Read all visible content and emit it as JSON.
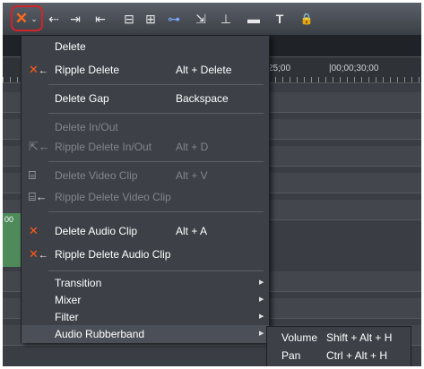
{
  "toolbar": {
    "delete_icon": "x-icon",
    "dropdown_arrow": "⌄",
    "glyphs": [
      "⇠",
      "⇥",
      "⇤",
      "⊟",
      "⊞",
      "⊶",
      "⇲",
      "⊥",
      "▬",
      "T",
      "🔒"
    ]
  },
  "timeline": {
    "ruler_left": "25;00",
    "ruler_right": "|00;00;30;00",
    "clip_label": "00"
  },
  "menu": {
    "items": [
      {
        "label": "Delete",
        "shortcut": "",
        "icon": "x-icon",
        "disabled": false
      },
      {
        "label": "Ripple Delete",
        "shortcut": "Alt + Delete",
        "icon": "ripple-x-icon",
        "disabled": false
      },
      {
        "label": "Delete Gap",
        "shortcut": "Backspace",
        "icon": "",
        "disabled": false
      },
      {
        "label": "Delete In/Out",
        "shortcut": "",
        "icon": "",
        "disabled": true
      },
      {
        "label": "Ripple Delete In/Out",
        "shortcut": "Alt + D",
        "icon": "ripple-inout-icon",
        "disabled": true
      },
      {
        "label": "Delete Video Clip",
        "shortcut": "Alt + V",
        "icon": "video-clip-icon",
        "disabled": true
      },
      {
        "label": "Ripple Delete Video Clip",
        "shortcut": "",
        "icon": "ripple-video-icon",
        "disabled": true
      },
      {
        "label": "Delete Audio Clip",
        "shortcut": "Alt + A",
        "icon": "audio-clip-icon",
        "disabled": false
      },
      {
        "label": "Ripple Delete Audio Clip",
        "shortcut": "",
        "icon": "ripple-audio-icon",
        "disabled": false
      },
      {
        "label": "Transition",
        "shortcut": "",
        "icon": "",
        "disabled": false,
        "submenu": true
      },
      {
        "label": "Mixer",
        "shortcut": "",
        "icon": "",
        "disabled": false,
        "submenu": true
      },
      {
        "label": "Filter",
        "shortcut": "",
        "icon": "",
        "disabled": false,
        "submenu": true
      },
      {
        "label": "Audio Rubberband",
        "shortcut": "",
        "icon": "",
        "disabled": false,
        "submenu": true
      }
    ]
  },
  "submenu": {
    "items": [
      {
        "label": "Volume",
        "shortcut": "Shift + Alt + H"
      },
      {
        "label": "Pan",
        "shortcut": "Ctrl + Alt + H"
      }
    ]
  }
}
